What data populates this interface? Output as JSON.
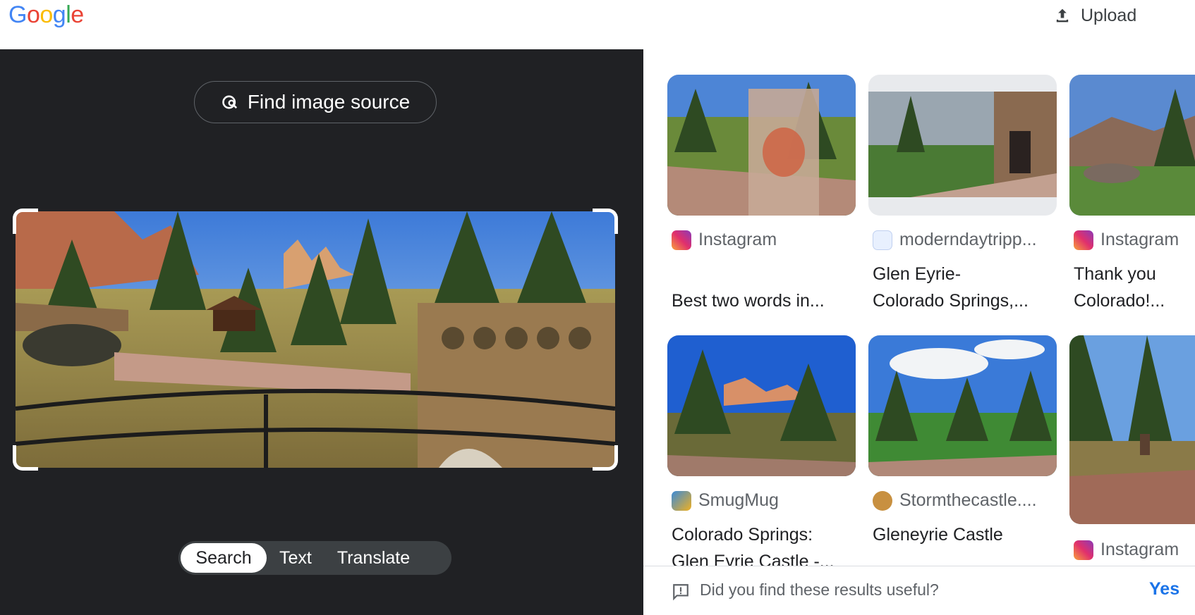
{
  "header": {
    "logo_letters": [
      "G",
      "o",
      "o",
      "g",
      "l",
      "e"
    ],
    "logo_colors": [
      "#4285f4",
      "#ea4335",
      "#fbbc05",
      "#4285f4",
      "#34a853",
      "#ea4335"
    ],
    "upload_label": "Upload",
    "upload_icon": "upload-icon"
  },
  "left_panel": {
    "find_source_label": "Find image source",
    "find_source_icon": "lens-search-icon",
    "modes": [
      {
        "label": "Search",
        "active": true
      },
      {
        "label": "Text",
        "active": false
      },
      {
        "label": "Translate",
        "active": false
      }
    ]
  },
  "results": [
    {
      "source": "Instagram",
      "favicon": "instagram-icon",
      "title_lines": [
        "Best two words in..."
      ]
    },
    {
      "source": "moderndaytripp...",
      "favicon": "moderndaytripper-icon",
      "title_lines": [
        "Glen Eyrie-",
        "Colorado Springs,..."
      ]
    },
    {
      "source": "Instagram",
      "favicon": "instagram-icon",
      "title_lines": [
        "Thank you",
        "Colorado!..."
      ]
    },
    {
      "source": "SmugMug",
      "favicon": "smugmug-icon",
      "title_lines": [
        "Colorado Springs:",
        "Glen Eyrie Castle -..."
      ]
    },
    {
      "source": "Stormthecastle....",
      "favicon": "stormthecastle-icon",
      "title_lines": [
        "Gleneyrie Castle"
      ]
    },
    {
      "source": "Instagram",
      "favicon": "instagram-icon",
      "title_lines": []
    }
  ],
  "feedback": {
    "question": "Did you find these results useful?",
    "yes_label": "Yes",
    "icon": "feedback-icon"
  },
  "colors": {
    "dark_panel": "#202124",
    "link_blue": "#1a73e8",
    "instagram_pink": "#e1306c"
  }
}
